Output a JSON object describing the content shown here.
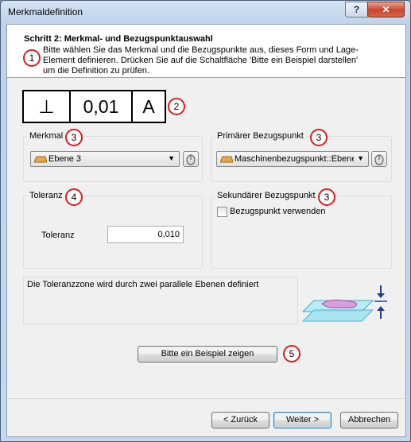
{
  "window": {
    "title": "Merkmaldefinition"
  },
  "titlebar_buttons": {
    "help": "?",
    "close": "✕"
  },
  "header": {
    "step_title": "Schritt 2: Merkmal- und Bezugspunktauswahl",
    "description": "Bitte wählen Sie das Merkmal und die Bezugspunkte aus, dieses Form und Lage-Element definieren. Drücken Sie auf die Schaltfläche 'Bitte ein Beispiel darstellen' um die Definition zu prüfen."
  },
  "badges": [
    "1",
    "2",
    "3",
    "3",
    "4",
    "3",
    "5"
  ],
  "fcf": {
    "symbol": "⊥",
    "tolerance": "0,01",
    "datum": "A"
  },
  "merkmal": {
    "label": "Merkmal",
    "value": "Ebene 3"
  },
  "primary": {
    "label": "Primärer Bezugspunkt",
    "value": "Maschinenbezugspunkt::Ebene"
  },
  "toleranz": {
    "group_label": "Toleranz",
    "field_label": "Toleranz",
    "value": "0,010"
  },
  "secondary": {
    "label": "Sekundärer Bezugspunkt",
    "checkbox_label": "Bezugspunkt verwenden",
    "checked": false
  },
  "info": {
    "text": "Die Toleranzzone wird durch zwei parallele Ebenen definiert"
  },
  "example_button": "Bitte ein Beispiel zeigen",
  "footer": {
    "back": "< Zurück",
    "next": "Weiter >",
    "cancel": "Abbrechen"
  },
  "icons": [
    "plane-icon",
    "cursor-pick-icon",
    "tolerance-zone-icon",
    "arrow-down-icon",
    "arrow-up-icon"
  ]
}
